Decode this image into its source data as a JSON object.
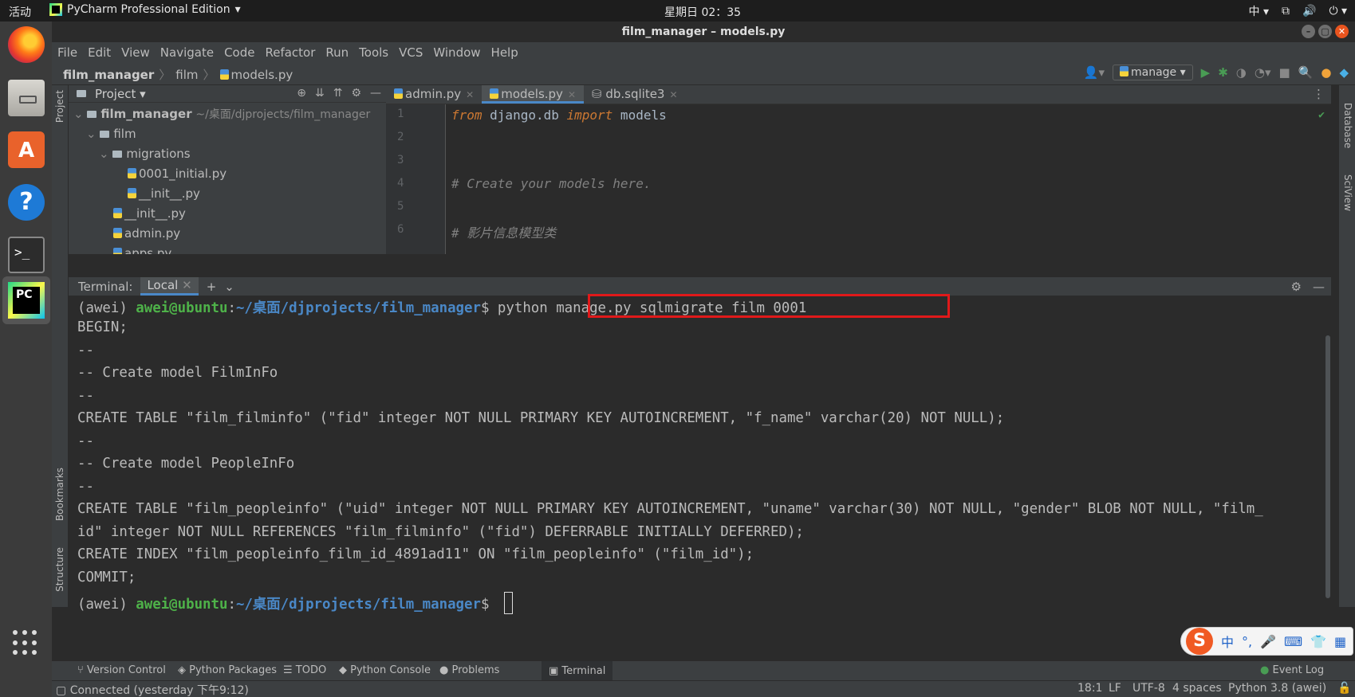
{
  "system": {
    "activities": "活动",
    "app_name": "PyCharm Professional Edition",
    "clock": "星期日 02：35",
    "ime_indicator": "中"
  },
  "window": {
    "title": "film_manager – models.py"
  },
  "menu": [
    "File",
    "Edit",
    "View",
    "Navigate",
    "Code",
    "Refactor",
    "Run",
    "Tools",
    "VCS",
    "Window",
    "Help"
  ],
  "breadcrumbs": {
    "project": "film_manager",
    "folder": "film",
    "file": "models.py"
  },
  "run_config": "manage",
  "project_panel": {
    "title": "Project",
    "root_name": "film_manager",
    "root_path": "~/桌面/djprojects/film_manager",
    "items": [
      {
        "label": "film"
      },
      {
        "label": "migrations"
      },
      {
        "label": "0001_initial.py"
      },
      {
        "label": "__init__.py"
      },
      {
        "label": "__init__.py"
      },
      {
        "label": "admin.py"
      },
      {
        "label": "apps.py"
      }
    ]
  },
  "left_strip": {
    "project": "Project",
    "bookmarks": "Bookmarks",
    "structure": "Structure"
  },
  "right_strip": {
    "database": "Database",
    "sciview": "SciView"
  },
  "editor": {
    "tabs": [
      {
        "label": "admin.py"
      },
      {
        "label": "models.py"
      },
      {
        "label": "db.sqlite3"
      }
    ],
    "line_numbers": [
      "1",
      "2",
      "3",
      "4",
      "5",
      "6"
    ],
    "line1": {
      "kw1": "from",
      "mod": " django.db ",
      "kw2": "import",
      "rest": " models"
    },
    "line4": "# Create your models here.",
    "line6": "# 影片信息模型类"
  },
  "terminal": {
    "label": "Terminal:",
    "tab": "Local",
    "prompt": {
      "env": "(awei) ",
      "user": "awei@ubuntu",
      "colon": ":",
      "path": "~/桌面/djprojects/film_manager",
      "dollar": "$ "
    },
    "command": "python manage.py sqlmigrate film 0001",
    "output": [
      "BEGIN;",
      "--",
      "-- Create model FilmInFo",
      "--",
      "CREATE TABLE \"film_filminfo\" (\"fid\" integer NOT NULL PRIMARY KEY AUTOINCREMENT, \"f_name\" varchar(20) NOT NULL);",
      "--",
      "-- Create model PeopleInFo",
      "--",
      "CREATE TABLE \"film_peopleinfo\" (\"uid\" integer NOT NULL PRIMARY KEY AUTOINCREMENT, \"uname\" varchar(30) NOT NULL, \"gender\" BLOB NOT NULL, \"film_",
      "id\" integer NOT NULL REFERENCES \"film_filminfo\" (\"fid\") DEFERRABLE INITIALLY DEFERRED);",
      "CREATE INDEX \"film_peopleinfo_film_id_4891ad11\" ON \"film_peopleinfo\" (\"film_id\");",
      "COMMIT;"
    ]
  },
  "tool_windows": {
    "version_control": "Version Control",
    "python_packages": "Python Packages",
    "todo": "TODO",
    "python_console": "Python Console",
    "problems": "Problems",
    "terminal": "Terminal",
    "event_log": "Event Log"
  },
  "status": {
    "connection": "Connected (yesterday 下午9:12)",
    "position": "18:1",
    "line_sep": "LF",
    "encoding": "UTF-8",
    "indent": "4 spaces",
    "interpreter": "Python 3.8 (awei)"
  },
  "ime_widget": {
    "logo": "S",
    "lang": "中",
    "punct": "°,"
  }
}
